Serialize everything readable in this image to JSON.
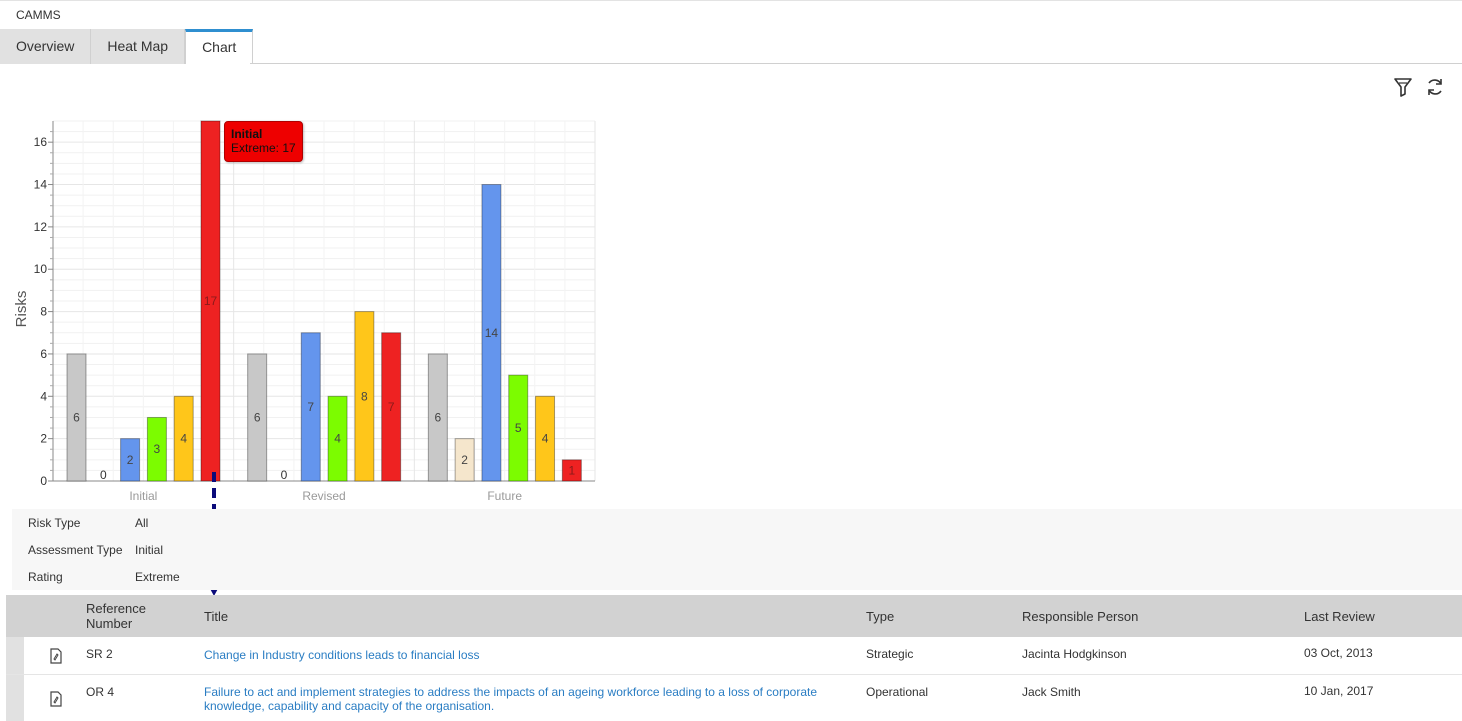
{
  "app": {
    "title": "CAMMS"
  },
  "tabs": [
    {
      "label": "Overview",
      "active": false
    },
    {
      "label": "Heat Map",
      "active": false
    },
    {
      "label": "Chart",
      "active": true
    }
  ],
  "toolbar": {
    "filter_icon": "filter-icon",
    "refresh_icon": "refresh-icon"
  },
  "tooltip": {
    "title": "Initial",
    "text": "Extreme: 17"
  },
  "chart_data": {
    "type": "bar",
    "ylabel": "Risks",
    "ylim": [
      0,
      17
    ],
    "yticks": [
      0,
      2,
      4,
      6,
      8,
      10,
      12,
      14,
      16
    ],
    "categories": [
      "Initial",
      "Revised",
      "Future"
    ],
    "series": [
      {
        "color": "#c8c8c8",
        "values": [
          6,
          6,
          6
        ]
      },
      {
        "color": "#f5e6cc",
        "values": [
          0,
          0,
          2
        ]
      },
      {
        "color": "#6495ed",
        "values": [
          2,
          7,
          14
        ]
      },
      {
        "color": "#7cfc00",
        "values": [
          3,
          4,
          5
        ]
      },
      {
        "color": "#ffc61a",
        "values": [
          4,
          8,
          4
        ]
      },
      {
        "color": "#ee2222",
        "values": [
          17,
          7,
          1
        ]
      }
    ],
    "grid": true
  },
  "filters": [
    {
      "label": "Risk Type",
      "value": "All"
    },
    {
      "label": "Assessment Type",
      "value": "Initial"
    },
    {
      "label": "Rating",
      "value": "Extreme"
    }
  ],
  "table": {
    "columns": {
      "ref": "Reference Number",
      "title": "Title",
      "type": "Type",
      "person": "Responsible Person",
      "review": "Last Review"
    },
    "rows": [
      {
        "ref": "SR 2",
        "title": "Change in Industry conditions leads to financial loss",
        "type": "Strategic",
        "person": "Jacinta Hodgkinson",
        "review": "03 Oct, 2013"
      },
      {
        "ref": "OR 4",
        "title": "Failure to act and implement strategies to address the impacts of an ageing workforce leading to a loss of corporate knowledge, capability and capacity of the organisation.",
        "type": "Operational",
        "person": "Jack Smith",
        "review": "10 Jan, 2017"
      }
    ]
  }
}
